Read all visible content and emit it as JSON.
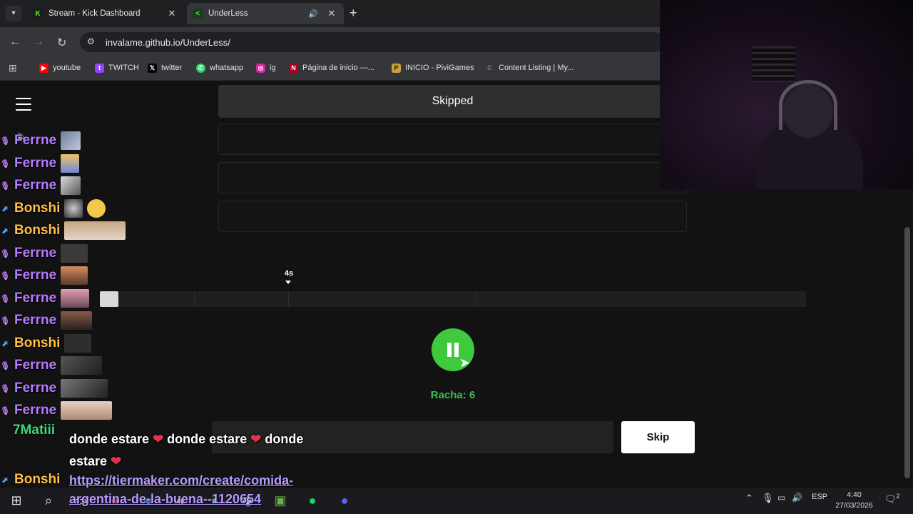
{
  "browser": {
    "tabs": [
      {
        "title": "Stream - Kick Dashboard",
        "favicon": "kick-icon"
      },
      {
        "title": "UnderLess",
        "favicon": "underless-icon"
      }
    ],
    "url": "invalame.github.io/UnderLess/",
    "bookmarks": [
      "youtube",
      "TWITCH",
      "twitter",
      "whatsapp",
      "ig",
      "Página de inicio —...",
      "INICIO - PiviGames",
      "Content Listing | My..."
    ]
  },
  "game": {
    "skipped_label": "Skipped",
    "marker": "4s",
    "progress": 0.026,
    "streak": "Racha: 6",
    "search_value": "",
    "skip_label": "Skip"
  },
  "chat": {
    "users": [
      "Ferrne",
      "Ferrne",
      "Ferrne",
      "Bonshi",
      "Bonshi",
      "Ferrne",
      "Ferrne",
      "Ferrne",
      "Ferrne",
      "Bonshi",
      "Ferrne",
      "Ferrne",
      "Ferrne"
    ],
    "last_user": "7Matiii",
    "msg_part1": "donde estare",
    "msg_part2": "donde estare",
    "msg_part3": "donde",
    "msg_part4": "estare",
    "link_user": "Bonshi",
    "link_line1": "https://tiermaker.com/create/comida-",
    "link_line2": "argentina-de-la-buena--1120654"
  },
  "taskbar": {
    "language": "ESP",
    "time": "4:40",
    "date": "27/03/2026",
    "notifications": "2"
  },
  "colors": {
    "ferrne": "#b57cff",
    "bonshi": "#ffbf4a",
    "matiii": "#3fd97a",
    "play_button": "#3ec93e",
    "streak": "#3fb950"
  }
}
